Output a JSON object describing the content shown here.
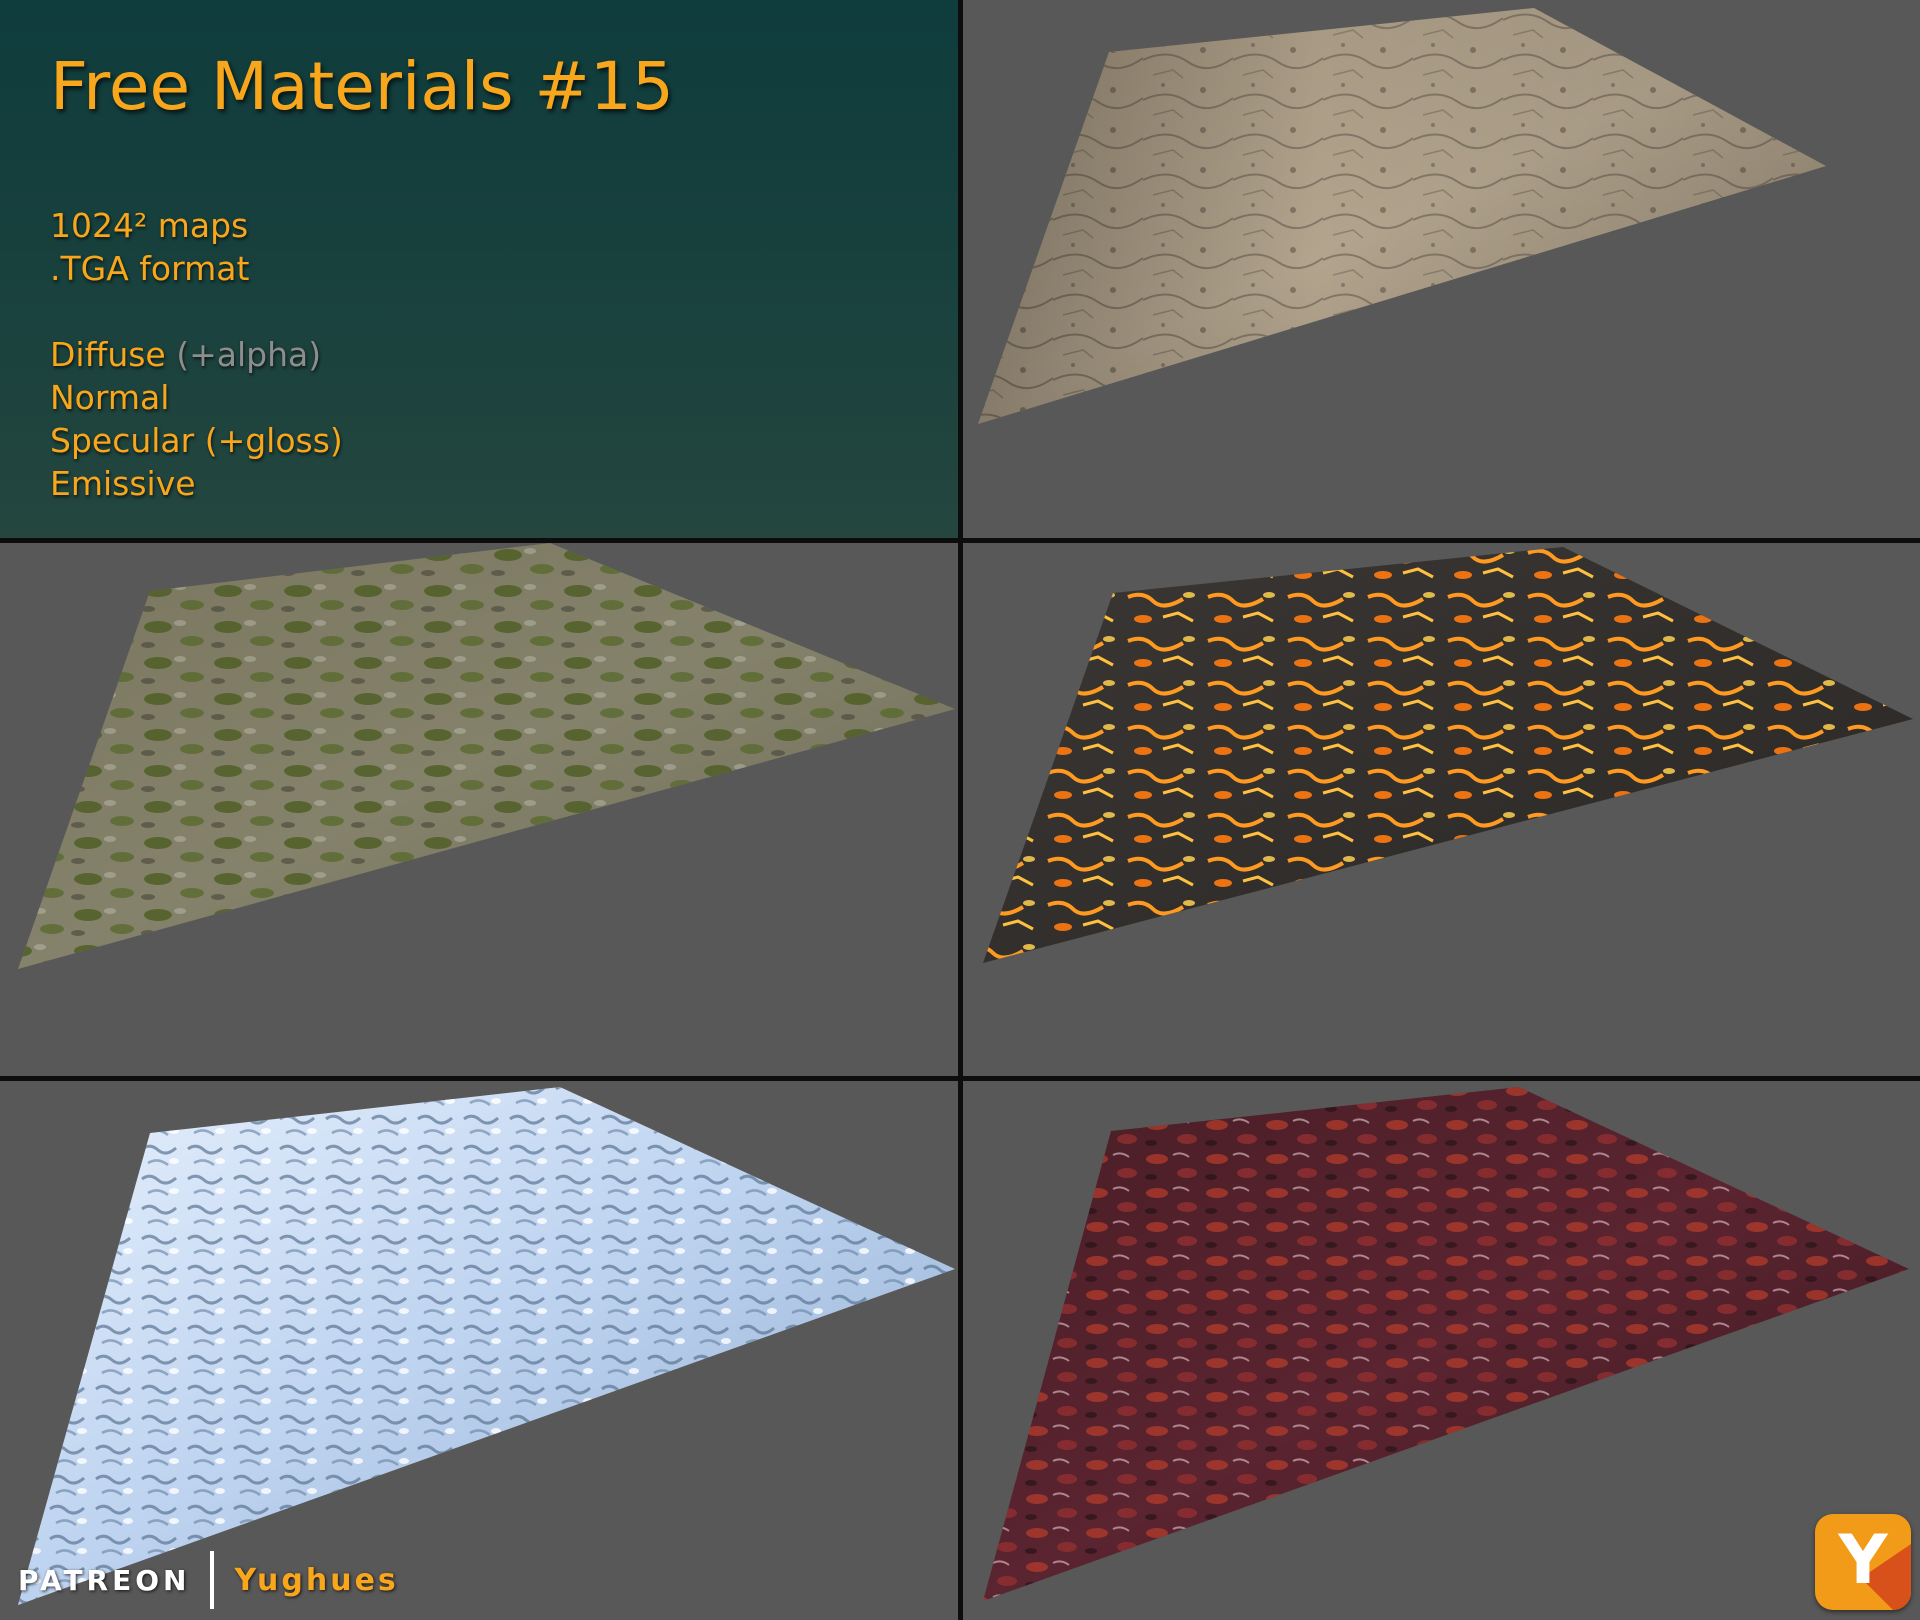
{
  "header": {
    "title": "Free Materials #15"
  },
  "specs": {
    "resolution": "1024² maps",
    "format": ".TGA format"
  },
  "maps": {
    "diffuse": "Diffuse",
    "diffuse_note": "(+alpha)",
    "normal": "Normal",
    "specular": "Specular (+gloss)",
    "emissive": "Emissive"
  },
  "footer": {
    "platform": "PATREON",
    "author": "Yughues"
  },
  "logo": {
    "glyph": "Y"
  },
  "materials": [
    {
      "id": "cracked-dirt",
      "colors": [
        "#a3957f",
        "#5e564a"
      ]
    },
    {
      "id": "mossy-rock",
      "colors": [
        "#7d7a60",
        "#4a5b25"
      ]
    },
    {
      "id": "lava",
      "colors": [
        "#2c2a28",
        "#ff8a1a"
      ]
    },
    {
      "id": "ice",
      "colors": [
        "#c8dbf5",
        "#5c7593"
      ]
    },
    {
      "id": "red-organic",
      "colors": [
        "#3b1a22",
        "#b23a2a"
      ]
    }
  ],
  "colors": {
    "accent": "#f8a61b",
    "panel_bg": "#585858",
    "info_bg": "#0f3c3d"
  }
}
